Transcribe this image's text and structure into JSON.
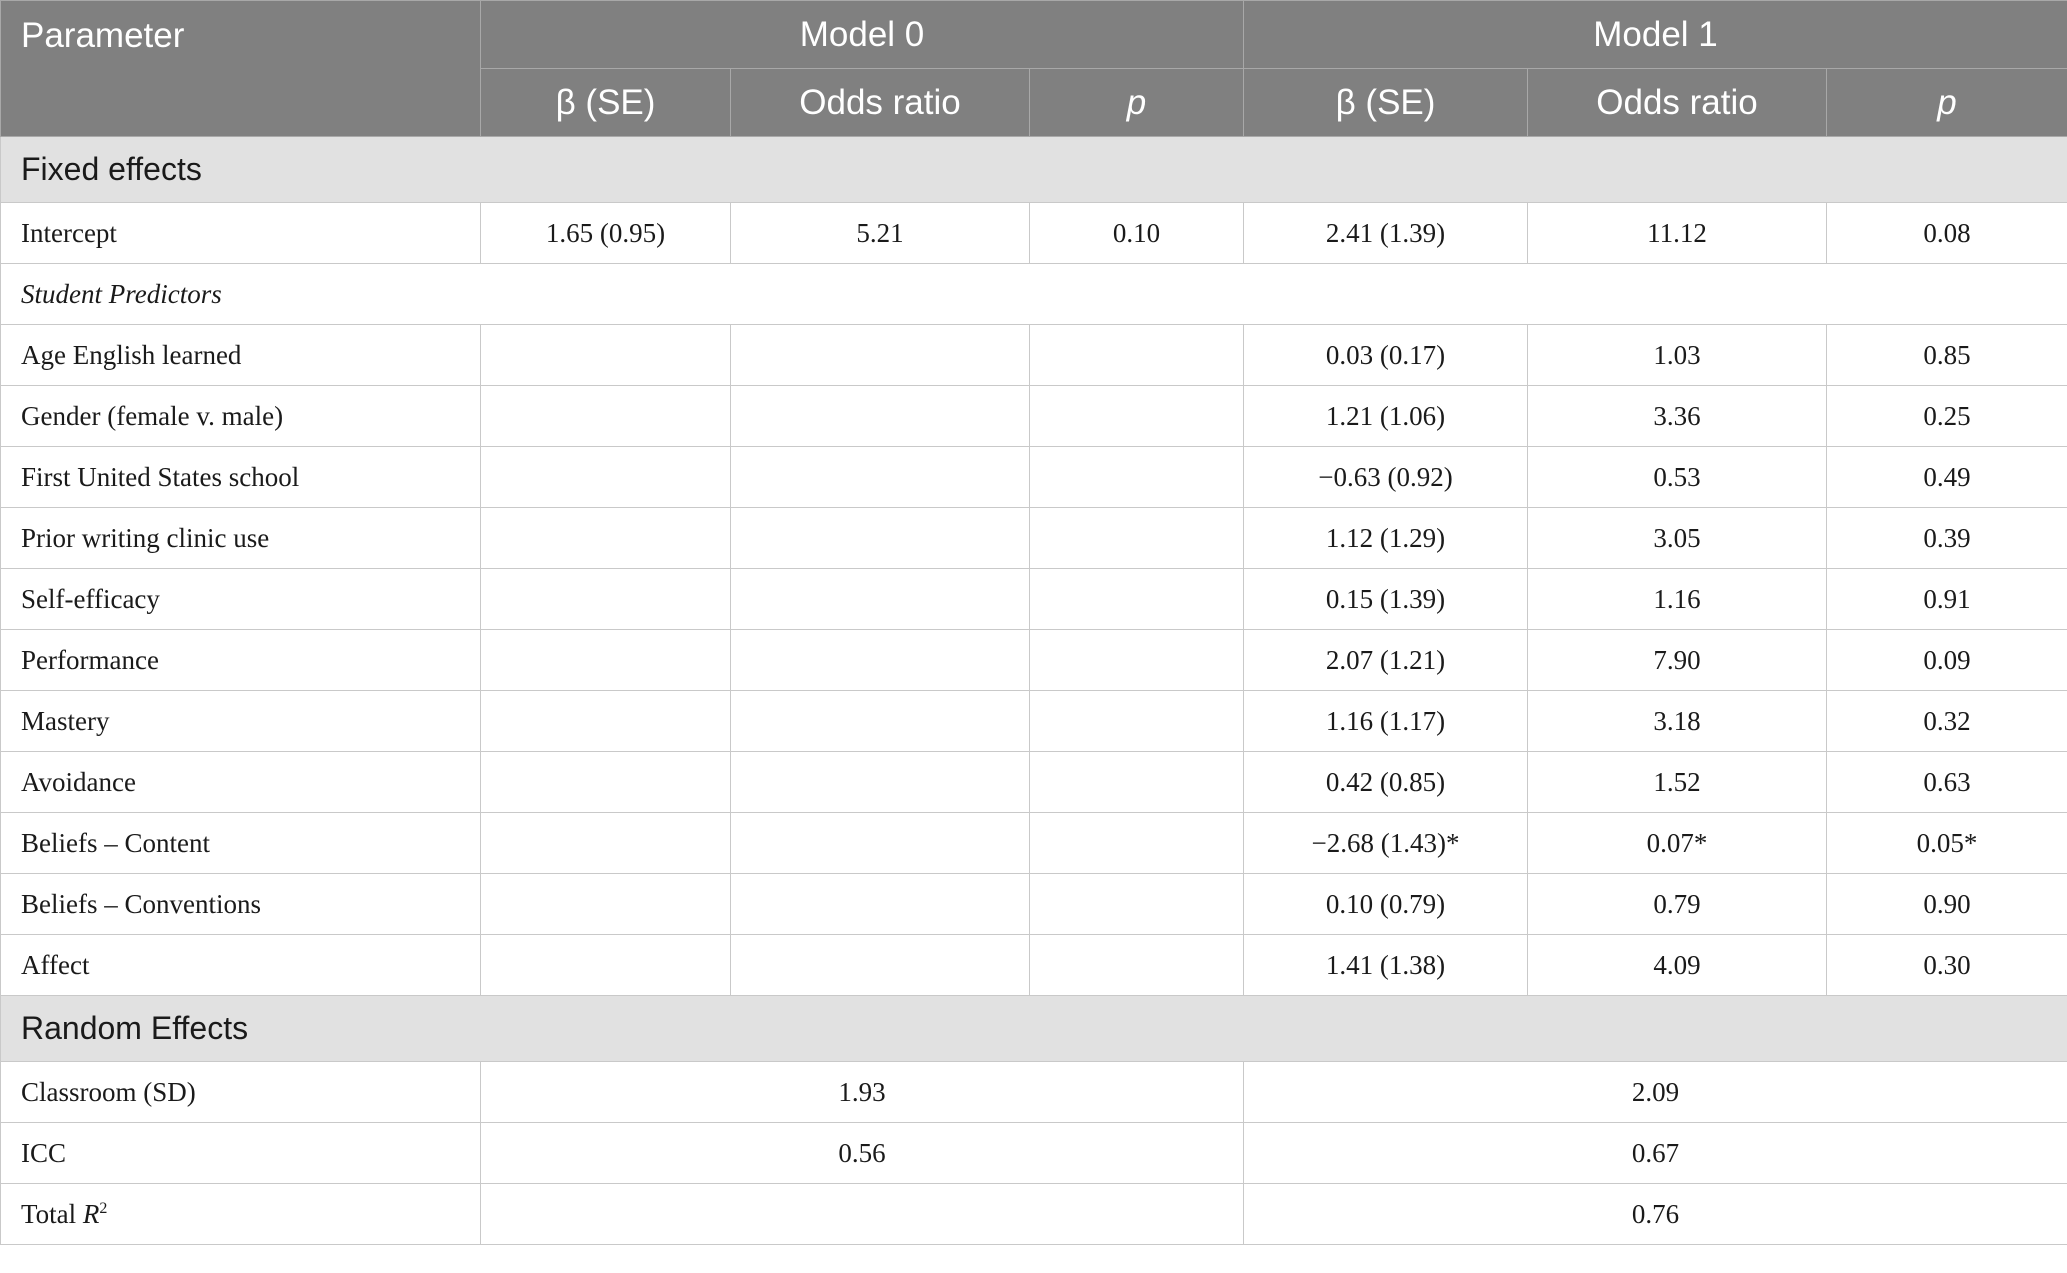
{
  "header": {
    "parameter": "Parameter",
    "model0": "Model 0",
    "model1": "Model 1",
    "beta_se": "β (SE)",
    "odds_ratio": "Odds ratio",
    "p": "p"
  },
  "sections": {
    "fixed": "Fixed effects",
    "random": "Random Effects"
  },
  "intercept": {
    "label": "Intercept",
    "m0_beta": "1.65 (0.95)",
    "m0_or": "5.21",
    "m0_p": "0.10",
    "m1_beta": "2.41 (1.39)",
    "m1_or": "11.12",
    "m1_p": "0.08"
  },
  "subheading": "Student Predictors",
  "predictors": [
    {
      "label": "Age English learned",
      "beta": "0.03 (0.17)",
      "or": "1.03",
      "p": "0.85"
    },
    {
      "label": "Gender (female v. male)",
      "beta": "1.21 (1.06)",
      "or": "3.36",
      "p": "0.25"
    },
    {
      "label": "First United States school",
      "beta": "−0.63 (0.92)",
      "or": "0.53",
      "p": "0.49"
    },
    {
      "label": "Prior writing clinic use",
      "beta": "1.12 (1.29)",
      "or": "3.05",
      "p": "0.39"
    },
    {
      "label": "Self-efficacy",
      "beta": "0.15 (1.39)",
      "or": "1.16",
      "p": "0.91"
    },
    {
      "label": "Performance",
      "beta": "2.07 (1.21)",
      "or": "7.90",
      "p": "0.09"
    },
    {
      "label": "Mastery",
      "beta": "1.16 (1.17)",
      "or": "3.18",
      "p": "0.32"
    },
    {
      "label": "Avoidance",
      "beta": "0.42 (0.85)",
      "or": "1.52",
      "p": "0.63"
    },
    {
      "label": "Beliefs – Content",
      "beta": "−2.68 (1.43)*",
      "or": "0.07*",
      "p": "0.05*"
    },
    {
      "label": "Beliefs – Conventions",
      "beta": "0.10 (0.79)",
      "or": "0.79",
      "p": "0.90"
    },
    {
      "label": "Affect",
      "beta": "1.41 (1.38)",
      "or": "4.09",
      "p": "0.30"
    }
  ],
  "random": [
    {
      "label": "Classroom (SD)",
      "m0": "1.93",
      "m1": "2.09"
    },
    {
      "label": "ICC",
      "m0": "0.56",
      "m1": "0.67"
    }
  ],
  "total_r2": {
    "label": "Total ",
    "label_italic": "R",
    "label_sup": "2",
    "m0": "",
    "m1": "0.76"
  },
  "colors": {
    "header_bg": "#808080",
    "section_bg": "#e1e1e1",
    "border": "#c9c9c9"
  }
}
